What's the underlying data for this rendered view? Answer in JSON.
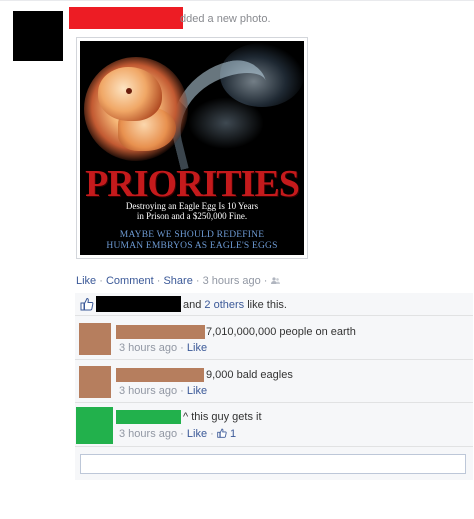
{
  "post": {
    "action_text": "dded a new photo."
  },
  "photo": {
    "headline": "PRIORITIES",
    "fine_line1": "Destroying an Eagle Egg Is 10 Years",
    "fine_line2": "in Prison and a $250,000 Fine.",
    "tagline_line1": "MAYBE WE SHOULD REDEFINE",
    "tagline_line2": "HUMAN EMBRYOS AS EAGLE'S EGGS"
  },
  "actions": {
    "like": "Like",
    "comment": "Comment",
    "share": "Share",
    "time": "3 hours ago",
    "separator": "·"
  },
  "likes": {
    "and": "and",
    "others": "2 others",
    "suffix": "like this."
  },
  "comments": [
    {
      "text": "7,010,000,000 people on earth",
      "time": "3 hours ago",
      "like": "Like"
    },
    {
      "text": "9,000 bald eagles",
      "time": "3 hours ago",
      "like": "Like"
    },
    {
      "text": "^ this guy gets it",
      "time": "3 hours ago",
      "like": "Like",
      "like_count": "1"
    }
  ],
  "colors": {
    "link": "#3b5998",
    "redact_red": "#ed1c24",
    "redact_tan": "#b67e5e",
    "redact_green": "#22b14c"
  },
  "icons": {
    "like": "thumbs-up-icon",
    "audience": "friends-icon"
  }
}
